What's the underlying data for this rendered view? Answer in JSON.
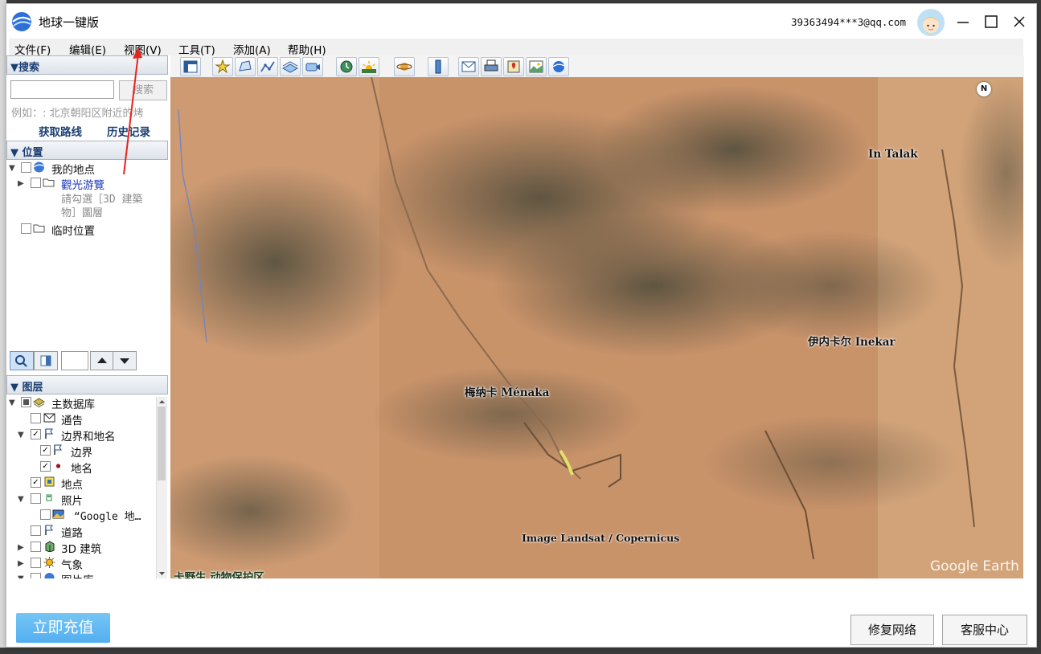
{
  "window": {
    "title": "地球一键版",
    "account": "39363494***3@qq.com"
  },
  "menu": [
    "文件(F)",
    "编辑(E)",
    "视图(V)",
    "工具(T)",
    "添加(A)",
    "帮助(H)"
  ],
  "search": {
    "header": "▼搜索",
    "input_value": "",
    "button_label": "搜索",
    "hint": "例如：: 北京朝阳区附近的烤",
    "get_route": "获取路线",
    "history": "历史记录"
  },
  "places": {
    "header": "▼ 位置",
    "items": [
      {
        "label": "我的地点"
      },
      {
        "label": "觀光游覽"
      },
      {
        "label": "請勾選［3D 建築"
      },
      {
        "label": "物］圖層"
      },
      {
        "label": "临时位置"
      }
    ]
  },
  "layers": {
    "header": "▼ 图层",
    "items": [
      {
        "label": "主数据库",
        "checked": "mixed"
      },
      {
        "label": "通告",
        "checked": false
      },
      {
        "label": "边界和地名",
        "checked": true
      },
      {
        "label": "边界",
        "checked": true
      },
      {
        "label": "地名",
        "checked": true
      },
      {
        "label": "地点",
        "checked": true
      },
      {
        "label": "照片",
        "checked": false
      },
      {
        "label": "“Google 地…",
        "checked": false
      },
      {
        "label": "道路",
        "checked": false
      },
      {
        "label": "3D 建筑",
        "checked": false
      },
      {
        "label": "气象",
        "checked": false
      },
      {
        "label": "图片库",
        "checked": false
      }
    ]
  },
  "map": {
    "labels": {
      "in_talak": "In Talak",
      "inekar": "伊内卡尔 Inekar",
      "menaka": "梅纳卡 Ménaka",
      "reserve": "卡野生 动物保护区"
    },
    "credit": "Image Landsat / Copernicus",
    "logo": "Google Earth",
    "north": "N"
  },
  "bottom": {
    "recharge": "立即充值",
    "repair": "修复网络",
    "support": "客服中心"
  },
  "colors": {
    "accent": "#1b3f73",
    "recharge": "#5ab4f2",
    "arrow": "#e8231c"
  }
}
